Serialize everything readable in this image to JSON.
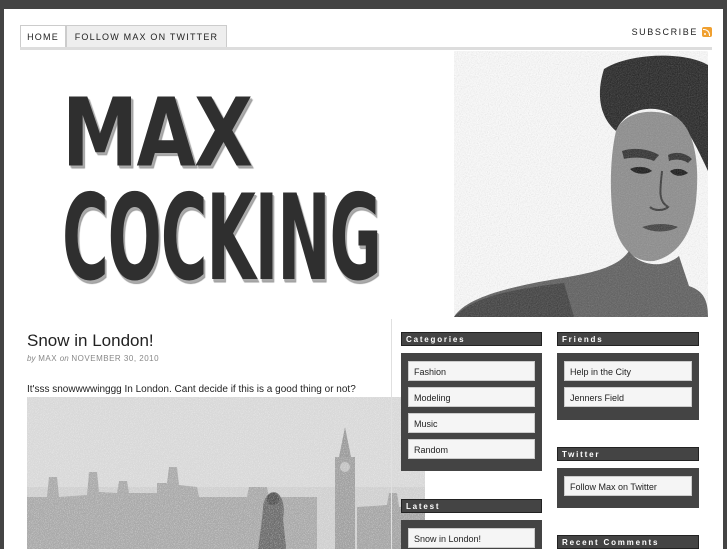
{
  "nav": {
    "tabs": [
      {
        "label": "HOME"
      },
      {
        "label": "FOLLOW MAX ON TWITTER"
      }
    ],
    "subscribe_label": "SUBSCRIBE",
    "subscribe_icon": "rss-icon"
  },
  "header": {
    "logo_line1": "MAX",
    "logo_line2": "COCKING"
  },
  "post": {
    "title": "Snow in London!",
    "meta_by": "by",
    "meta_author": "MAX",
    "meta_on": "on",
    "meta_date": "NOVEMBER 30, 2010",
    "excerpt": "It'sss snowwwwinggg In London. Cant decide if this is a good thing or not?"
  },
  "sidebar": {
    "categories": {
      "title": "Categories",
      "items": [
        "Fashion",
        "Modeling",
        "Music",
        "Random"
      ]
    },
    "latest": {
      "title": "Latest",
      "items": [
        "Snow in London!"
      ]
    },
    "friends": {
      "title": "Friends",
      "items": [
        "Help in the City",
        "Jenners Field"
      ]
    },
    "twitter": {
      "title": "Twitter",
      "items": [
        "Follow Max on Twitter"
      ]
    },
    "recent_comments": {
      "title": "Recent Comments"
    }
  },
  "colors": {
    "widget_bg": "#444444",
    "rss": "#f0a030"
  }
}
